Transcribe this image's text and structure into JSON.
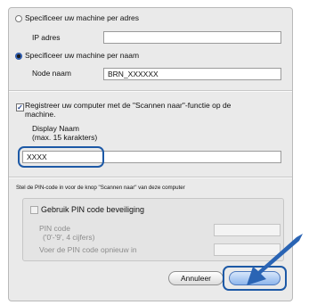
{
  "by_address": {
    "label": "Specificeer uw machine per adres",
    "selected": false,
    "ip_label": "IP adres",
    "ip_value": ""
  },
  "by_name": {
    "label": "Specificeer uw machine per naam",
    "selected": true,
    "node_label": "Node naam",
    "node_value": "BRN_XXXXXX"
  },
  "register": {
    "checked": true,
    "label_line1": "Registreer uw computer met de \"Scannen naar\"-functie op de",
    "label_line2": "machine.",
    "display_label_line1": "Display Naam",
    "display_label_line2": "(max. 15 karakters)",
    "display_value": "XXXX"
  },
  "pin": {
    "section_title": "Stel de PIN-code in voor de knop \"Scannen naar\" van deze computer",
    "use_pin_label": "Gebruik PIN code beveiliging",
    "use_pin_checked": false,
    "pin_label_line1": "PIN code",
    "pin_label_line2": "('0'-'9', 4 cijfers)",
    "pin_value": "",
    "confirm_label": "Voer de PIN code opnieuw in",
    "confirm_value": ""
  },
  "buttons": {
    "cancel": "Annuleer",
    "ok": "OK"
  },
  "colors": {
    "highlight": "#1d59a6",
    "arrow": "#2a64b4"
  }
}
